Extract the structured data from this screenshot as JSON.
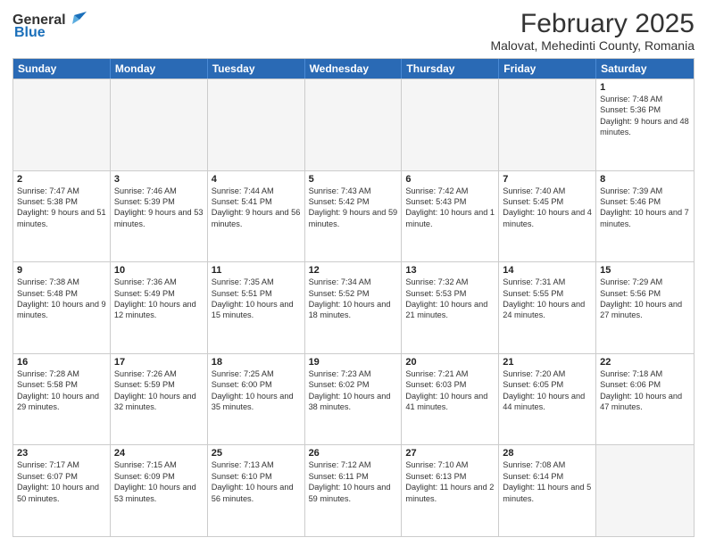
{
  "header": {
    "logo_general": "General",
    "logo_blue": "Blue",
    "main_title": "February 2025",
    "subtitle": "Malovat, Mehedinti County, Romania"
  },
  "weekdays": [
    "Sunday",
    "Monday",
    "Tuesday",
    "Wednesday",
    "Thursday",
    "Friday",
    "Saturday"
  ],
  "rows": [
    [
      {
        "day": "",
        "info": ""
      },
      {
        "day": "",
        "info": ""
      },
      {
        "day": "",
        "info": ""
      },
      {
        "day": "",
        "info": ""
      },
      {
        "day": "",
        "info": ""
      },
      {
        "day": "",
        "info": ""
      },
      {
        "day": "1",
        "info": "Sunrise: 7:48 AM\nSunset: 5:36 PM\nDaylight: 9 hours and 48 minutes."
      }
    ],
    [
      {
        "day": "2",
        "info": "Sunrise: 7:47 AM\nSunset: 5:38 PM\nDaylight: 9 hours and 51 minutes."
      },
      {
        "day": "3",
        "info": "Sunrise: 7:46 AM\nSunset: 5:39 PM\nDaylight: 9 hours and 53 minutes."
      },
      {
        "day": "4",
        "info": "Sunrise: 7:44 AM\nSunset: 5:41 PM\nDaylight: 9 hours and 56 minutes."
      },
      {
        "day": "5",
        "info": "Sunrise: 7:43 AM\nSunset: 5:42 PM\nDaylight: 9 hours and 59 minutes."
      },
      {
        "day": "6",
        "info": "Sunrise: 7:42 AM\nSunset: 5:43 PM\nDaylight: 10 hours and 1 minute."
      },
      {
        "day": "7",
        "info": "Sunrise: 7:40 AM\nSunset: 5:45 PM\nDaylight: 10 hours and 4 minutes."
      },
      {
        "day": "8",
        "info": "Sunrise: 7:39 AM\nSunset: 5:46 PM\nDaylight: 10 hours and 7 minutes."
      }
    ],
    [
      {
        "day": "9",
        "info": "Sunrise: 7:38 AM\nSunset: 5:48 PM\nDaylight: 10 hours and 9 minutes."
      },
      {
        "day": "10",
        "info": "Sunrise: 7:36 AM\nSunset: 5:49 PM\nDaylight: 10 hours and 12 minutes."
      },
      {
        "day": "11",
        "info": "Sunrise: 7:35 AM\nSunset: 5:51 PM\nDaylight: 10 hours and 15 minutes."
      },
      {
        "day": "12",
        "info": "Sunrise: 7:34 AM\nSunset: 5:52 PM\nDaylight: 10 hours and 18 minutes."
      },
      {
        "day": "13",
        "info": "Sunrise: 7:32 AM\nSunset: 5:53 PM\nDaylight: 10 hours and 21 minutes."
      },
      {
        "day": "14",
        "info": "Sunrise: 7:31 AM\nSunset: 5:55 PM\nDaylight: 10 hours and 24 minutes."
      },
      {
        "day": "15",
        "info": "Sunrise: 7:29 AM\nSunset: 5:56 PM\nDaylight: 10 hours and 27 minutes."
      }
    ],
    [
      {
        "day": "16",
        "info": "Sunrise: 7:28 AM\nSunset: 5:58 PM\nDaylight: 10 hours and 29 minutes."
      },
      {
        "day": "17",
        "info": "Sunrise: 7:26 AM\nSunset: 5:59 PM\nDaylight: 10 hours and 32 minutes."
      },
      {
        "day": "18",
        "info": "Sunrise: 7:25 AM\nSunset: 6:00 PM\nDaylight: 10 hours and 35 minutes."
      },
      {
        "day": "19",
        "info": "Sunrise: 7:23 AM\nSunset: 6:02 PM\nDaylight: 10 hours and 38 minutes."
      },
      {
        "day": "20",
        "info": "Sunrise: 7:21 AM\nSunset: 6:03 PM\nDaylight: 10 hours and 41 minutes."
      },
      {
        "day": "21",
        "info": "Sunrise: 7:20 AM\nSunset: 6:05 PM\nDaylight: 10 hours and 44 minutes."
      },
      {
        "day": "22",
        "info": "Sunrise: 7:18 AM\nSunset: 6:06 PM\nDaylight: 10 hours and 47 minutes."
      }
    ],
    [
      {
        "day": "23",
        "info": "Sunrise: 7:17 AM\nSunset: 6:07 PM\nDaylight: 10 hours and 50 minutes."
      },
      {
        "day": "24",
        "info": "Sunrise: 7:15 AM\nSunset: 6:09 PM\nDaylight: 10 hours and 53 minutes."
      },
      {
        "day": "25",
        "info": "Sunrise: 7:13 AM\nSunset: 6:10 PM\nDaylight: 10 hours and 56 minutes."
      },
      {
        "day": "26",
        "info": "Sunrise: 7:12 AM\nSunset: 6:11 PM\nDaylight: 10 hours and 59 minutes."
      },
      {
        "day": "27",
        "info": "Sunrise: 7:10 AM\nSunset: 6:13 PM\nDaylight: 11 hours and 2 minutes."
      },
      {
        "day": "28",
        "info": "Sunrise: 7:08 AM\nSunset: 6:14 PM\nDaylight: 11 hours and 5 minutes."
      },
      {
        "day": "",
        "info": ""
      }
    ]
  ]
}
